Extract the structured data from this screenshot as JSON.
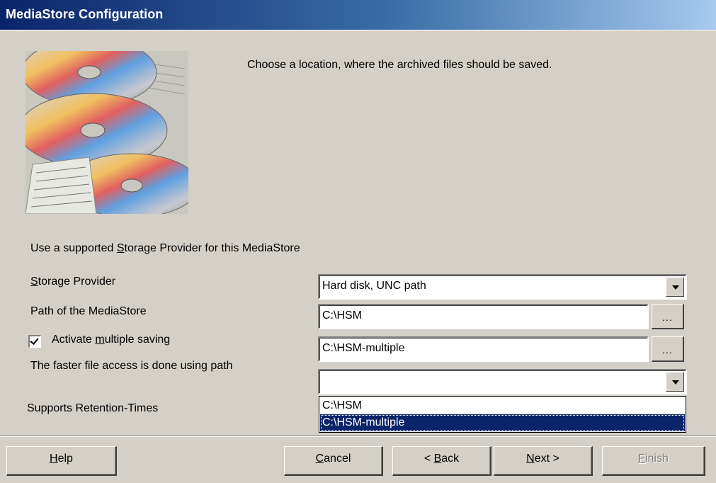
{
  "window": {
    "title": "MediaStore Configuration"
  },
  "intro": {
    "text": "Choose a location, where the archived files should be saved."
  },
  "section": {
    "provider_heading_prefix": "Use a supported ",
    "provider_heading_accel": "S",
    "provider_heading_rest": "torage Provider for this MediaStore"
  },
  "form": {
    "storage_provider": {
      "label_accel": "S",
      "label_rest": "torage Provider",
      "value": "Hard disk, UNC path"
    },
    "path": {
      "label": "Path of the MediaStore",
      "value": "C:\\HSM",
      "browse_label": "..."
    },
    "multiple_saving": {
      "checked": true,
      "label_prefix": "Activate ",
      "label_accel": "m",
      "label_rest": "ultiple saving",
      "value": "C:\\HSM-multiple",
      "browse_label": "..."
    },
    "faster_access": {
      "label": "The faster file access is done using path",
      "value": "",
      "options": [
        "C:\\HSM",
        "C:\\HSM-multiple"
      ],
      "selected_index": 1
    },
    "retention": {
      "label": "Supports Retention-Times"
    }
  },
  "buttons": {
    "help": {
      "accel": "H",
      "rest": "elp"
    },
    "cancel": {
      "accel": "C",
      "rest": "ancel"
    },
    "back": {
      "prefix": "< ",
      "accel": "B",
      "rest": "ack"
    },
    "next": {
      "accel": "N",
      "rest": "ext >"
    },
    "finish": {
      "accel": "F",
      "rest": "inish",
      "disabled": true
    }
  },
  "colors": {
    "titlebar_start": "#0a246a",
    "titlebar_end": "#a6caf0",
    "face": "#d4d0c8",
    "selection": "#0a246a"
  }
}
